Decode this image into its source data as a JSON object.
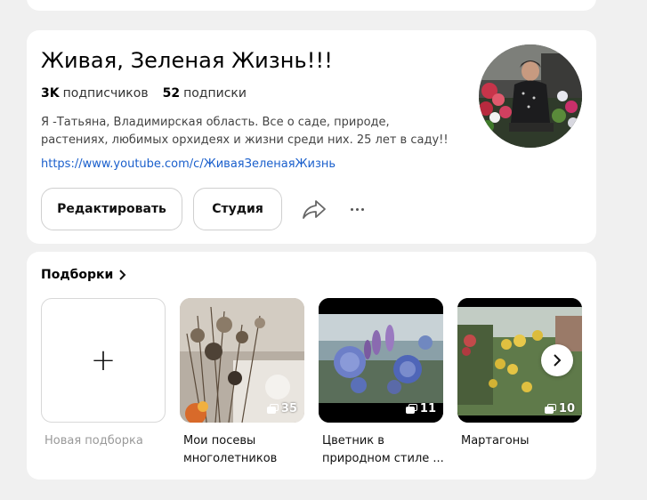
{
  "channel": {
    "title": "Живая, Зеленая Жизнь!!!",
    "subscribers_count": "3K",
    "subscribers_label": "подписчиков",
    "subscriptions_count": "52",
    "subscriptions_label": "подписки",
    "bio": "Я -Татьяна, Владимирская область. Все о саде, природе, растениях, любимых орхидеях и жизни среди них. 25 лет в саду!!",
    "link": "https://www.youtube.com/c/ЖиваяЗеленаяЖизнь"
  },
  "actions": {
    "edit_label": "Редактировать",
    "studio_label": "Студия",
    "share_icon": "share-arrow-icon",
    "more_icon": "more-dots-icon"
  },
  "collections": {
    "title": "Подборки",
    "new_label": "Новая подборка",
    "items": [
      {
        "label": "Мои посевы многолетников",
        "count": "35"
      },
      {
        "label": "Цветник в природном стиле ...",
        "count": "11"
      },
      {
        "label": "Мартагоны",
        "count": "10"
      }
    ]
  },
  "colors": {
    "page_bg": "#f0f0f0",
    "card_bg": "#ffffff",
    "link": "#1a5fcc"
  }
}
